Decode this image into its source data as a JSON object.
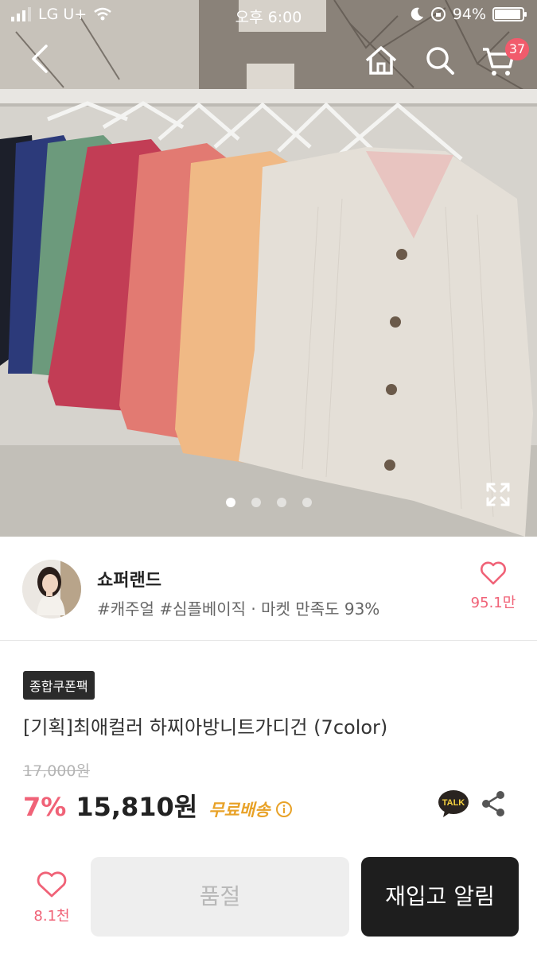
{
  "status_bar": {
    "carrier": "LG U+",
    "time": "오후 6:00",
    "battery_percent": "94%",
    "battery_level": 0.94
  },
  "nav": {
    "cart_count": "37"
  },
  "gallery": {
    "page_count": 4,
    "active_index": 0
  },
  "store": {
    "name": "쇼퍼랜드",
    "tags": "#캐주얼 #심플베이직 · 마켓 만족도 93%",
    "like_count": "95.1만"
  },
  "product": {
    "coupon_badge": "종합쿠폰팩",
    "title": "[기획]최애컬러 하찌아방니트가디건 (7color)",
    "original_price": "17,000원",
    "discount": "7%",
    "price": "15,810원",
    "shipping": "무료배송",
    "talk_label": "TALK"
  },
  "bottom_bar": {
    "like_count": "8.1천",
    "sold_out_label": "품절",
    "restock_label": "재입고 알림"
  },
  "colors": {
    "accent": "#f06277",
    "shipping": "#e8a228",
    "dark_button": "#1e1e1e"
  }
}
